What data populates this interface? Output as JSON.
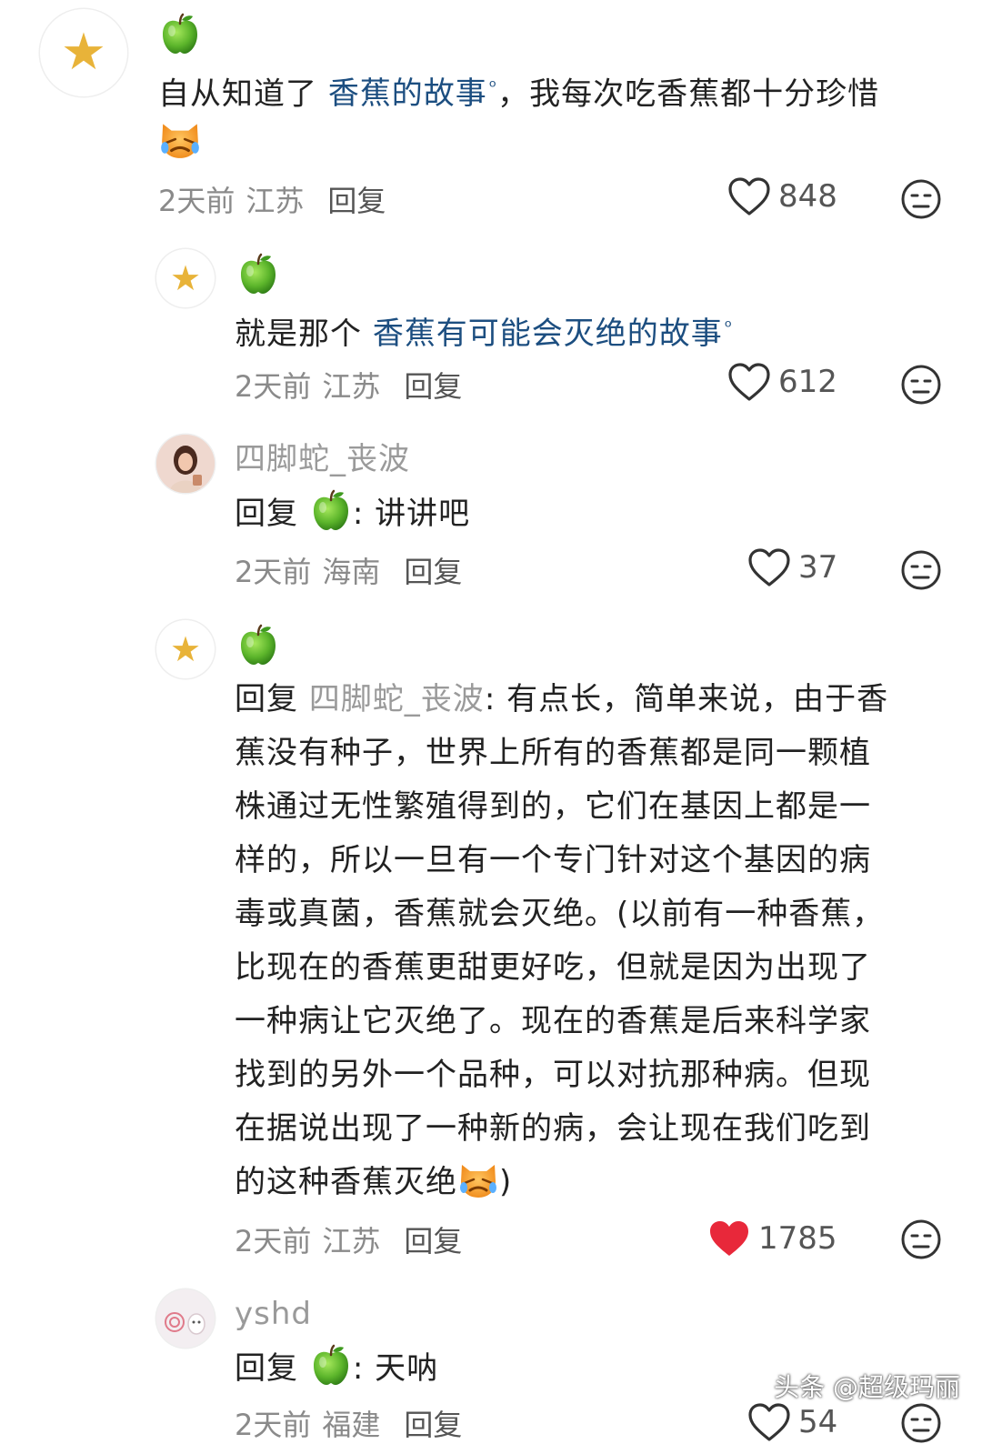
{
  "comments": [
    {
      "text_prefix": "自从知道了 ",
      "link": "香蕉的故事",
      "text_suffix": "，我每次吃香蕉都十分珍惜",
      "time": "2天前",
      "location": "江苏",
      "reply_label": "回复",
      "likes": "848"
    },
    {
      "text_prefix": "就是那个 ",
      "link": "香蕉有可能会灭绝的故事",
      "time": "2天前",
      "location": "江苏",
      "reply_label": "回复",
      "likes": "612"
    },
    {
      "username": "四脚蛇_丧波",
      "reply_prefix": "回复",
      "text": ": 讲讲吧",
      "time": "2天前",
      "location": "海南",
      "reply_label": "回复",
      "likes": "37"
    },
    {
      "reply_prefix": "回复",
      "reply_to": "四脚蛇_丧波",
      "lines": [
        ": 有点长，简单来说，由于香",
        "蕉没有种子，世界上所有的香蕉都是同一颗植",
        "株通过无性繁殖得到的，它们在基因上都是一",
        "样的，所以一旦有一个专门针对这个基因的病",
        "毒或真菌，香蕉就会灭绝。(以前有一种香蕉，",
        "比现在的香蕉更甜更好吃，但就是因为出现了",
        "一种病让它灭绝了。现在的香蕉是后来科学家",
        "找到的另外一个品种，可以对抗那种病。但现",
        "在据说出现了一种新的病，会让现在我们吃到",
        "的这种香蕉灭绝"
      ],
      "last_suffix": ")",
      "time": "2天前",
      "location": "江苏",
      "reply_label": "回复",
      "likes": "1785",
      "liked": true
    },
    {
      "username": "yshd",
      "reply_prefix": "回复",
      "text": ": 天呐",
      "time": "2天前",
      "location": "福建",
      "reply_label": "回复",
      "likes": "54"
    }
  ],
  "watermark": "头条 @超级玛丽",
  "colors": {
    "link": "#1c4e80",
    "username": "#9a9a9a",
    "meta": "#8a8a8a",
    "liked_heart": "#e8283a",
    "star": "#e8b339"
  }
}
